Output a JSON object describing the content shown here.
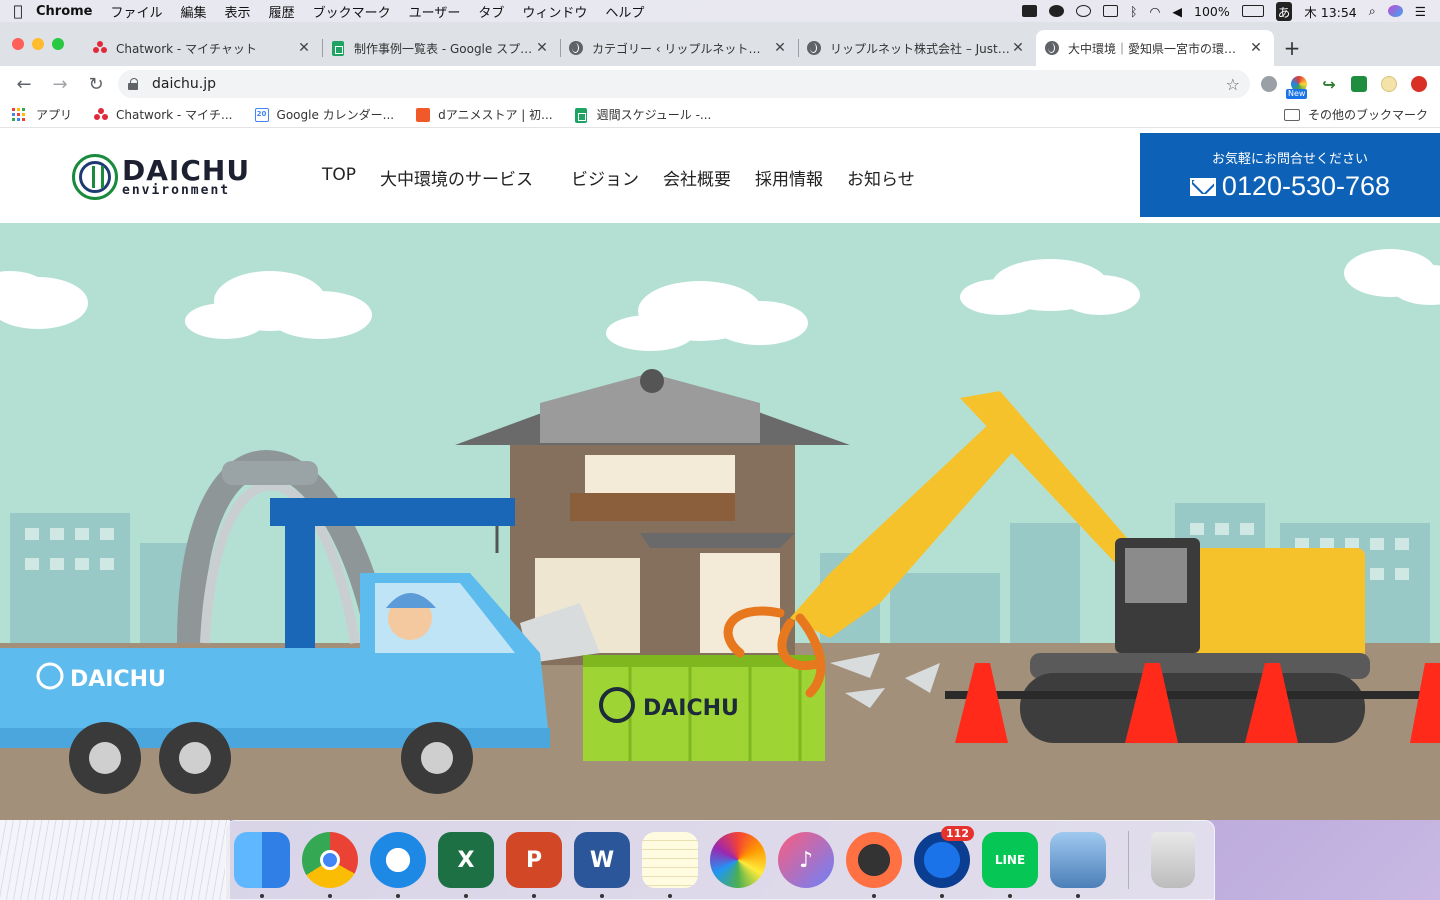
{
  "colors": {
    "accent": "#0d61b6",
    "logo_green": "#1a8a3c",
    "logo_navy": "#1f3b73",
    "sky": "#b4e0d3",
    "road": "#a3907b"
  },
  "menubar": {
    "app": "Chrome",
    "menus": [
      "ファイル",
      "編集",
      "表示",
      "履歴",
      "ブックマーク",
      "ユーザー",
      "タブ",
      "ウィンドウ",
      "ヘルプ"
    ],
    "battery": "100%",
    "input_method": "あ",
    "clock": "木 13:54",
    "status_icons": [
      "dropbox-icon",
      "creative-cloud-icon",
      "line-icon",
      "screen-icon",
      "bluetooth-icon",
      "wifi-icon",
      "volume-icon",
      "battery-icon",
      "search-icon",
      "siri-icon",
      "list-icon"
    ]
  },
  "tabs": [
    {
      "title": "Chatwork - マイチャット",
      "icon": "chatwork-icon"
    },
    {
      "title": "制作事例一覧表 - Google スプレッドシート",
      "icon": "sheets-icon"
    },
    {
      "title": "カテゴリー ‹ リップルネット株式会社",
      "icon": "globe-icon"
    },
    {
      "title": "リップルネット株式会社 – Just another",
      "icon": "globe-icon"
    },
    {
      "title": "大中環境｜愛知県一宮市の環境総合",
      "icon": "globe-icon",
      "active": true
    }
  ],
  "toolbar": {
    "url": "daichu.jp",
    "ext_badge": "New"
  },
  "bookmarks": [
    {
      "label": "アプリ",
      "icon": "apps-icon"
    },
    {
      "label": "Chatwork - マイチ...",
      "icon": "chatwork-icon"
    },
    {
      "label": "Google カレンダー...",
      "icon": "calendar-icon",
      "badge": "20"
    },
    {
      "label": "dアニメストア | 初...",
      "icon": "danime-icon"
    },
    {
      "label": "週間スケジュール -...",
      "icon": "sheets-icon"
    }
  ],
  "bookmarks_other": "その他のブックマーク",
  "site": {
    "logo_big": "DAICHU",
    "logo_small": "environment",
    "nav": [
      "TOP",
      "大中環境のサービス",
      "ビジョン",
      "会社概要",
      "採用情報",
      "お知らせ"
    ],
    "contact_label": "お気軽にお問合せください",
    "contact_phone": "0120-530-768",
    "truck_brand": "DAICHU",
    "container_brand": "DAICHU"
  },
  "dock": {
    "apps": [
      "Finder",
      "Chrome",
      "Safari",
      "Excel",
      "PowerPoint",
      "Word",
      "Notes",
      "Photos",
      "iTunes",
      "Pixelmator",
      "Thunderbird",
      "LINE",
      "Preview"
    ],
    "thunderbird_badge": "112",
    "trash": "Trash"
  }
}
